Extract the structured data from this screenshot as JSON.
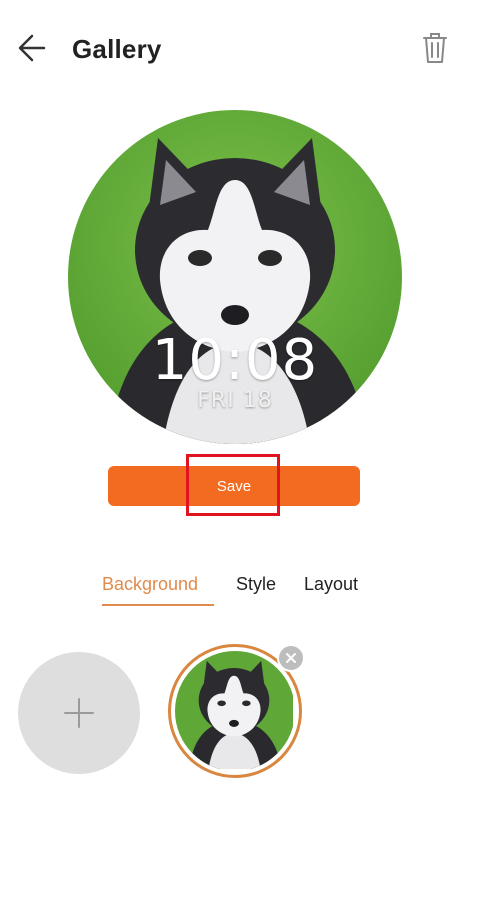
{
  "header": {
    "title": "Gallery",
    "back_icon": "arrow-left-icon",
    "delete_icon": "trash-icon"
  },
  "watch_face": {
    "time": "10:08",
    "date": "FRI 18",
    "image": "husky-puppy-on-grass"
  },
  "save_button": {
    "label": "Save"
  },
  "tabs": [
    {
      "label": "Background",
      "selected": true
    },
    {
      "label": "Style",
      "selected": false
    },
    {
      "label": "Layout",
      "selected": false
    }
  ],
  "thumbnails": {
    "add_icon": "plus-icon",
    "remove_icon": "close-icon",
    "selected_image": "husky-puppy-on-grass"
  },
  "colors": {
    "accent": "#f26b21",
    "tab_selected": "#e08a4c",
    "highlight": "#e0141e",
    "add_bg": "#dedede"
  }
}
